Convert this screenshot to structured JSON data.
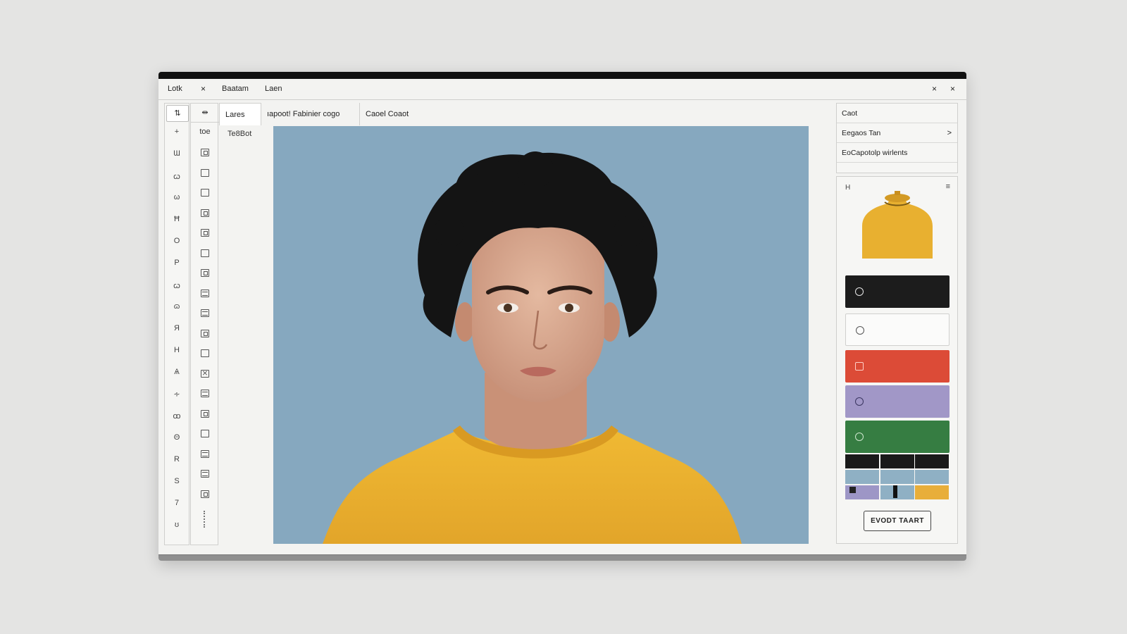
{
  "menubar": {
    "items": [
      "Lotk",
      "Baatam",
      "Laen"
    ],
    "close_glyph": "×"
  },
  "toolstrip": {
    "first": "⇅",
    "tools": [
      "+",
      "Ɯ",
      "ꞷ",
      "ω",
      "Ħ",
      "O",
      "P",
      "ꞷ",
      "ɷ",
      "Я",
      "H",
      "Ѧ",
      "∻",
      "ꝏ",
      "Θ",
      "R",
      "S",
      "7",
      "ʊ"
    ]
  },
  "iconstrip": {
    "first": "⇹",
    "label": "toe",
    "icons": [
      "dot",
      "box",
      "box",
      "dot",
      "dot",
      "box",
      "dot",
      "lines",
      "lines",
      "dot",
      "box",
      "cross",
      "lines",
      "dot",
      "box",
      "lines",
      "lines",
      "dot"
    ]
  },
  "tabs": {
    "tab1": "Lares",
    "tab2": "ıapoot! Fabinier cogo",
    "tab3": "Caoel Coaot",
    "layer_label": "Te8Bot"
  },
  "rightpanel": {
    "row1": "Caot",
    "row2": "Eegaos Tan",
    "row2_chevron": ">",
    "row3": "EoCapotolp wirlents"
  },
  "swatchpanel": {
    "header": "H",
    "menu_glyph": "≡",
    "swatches": [
      {
        "name": "black",
        "color": "#1c1c1c",
        "icon_color": "#e8e8e8"
      },
      {
        "name": "white",
        "color": "#fbfbfa",
        "icon_color": "#555555"
      },
      {
        "name": "red",
        "color": "#dc4b37",
        "icon_color": "#ffd0c8"
      },
      {
        "name": "purple",
        "color": "#a197c7",
        "icon_color": "#3a3560"
      },
      {
        "name": "green",
        "color": "#367d42",
        "icon_color": "#cfe8cf"
      }
    ],
    "grid_colors": [
      "#1a1a1a",
      "#8fb0c4",
      "#9d96c6",
      "#e8ae3a"
    ],
    "export_label": "EVODT TAART"
  },
  "colors": {
    "canvas_bg": "#86a8bf",
    "shirt": "#e8b030",
    "hair": "#141414",
    "skin": "#d6a88c"
  }
}
